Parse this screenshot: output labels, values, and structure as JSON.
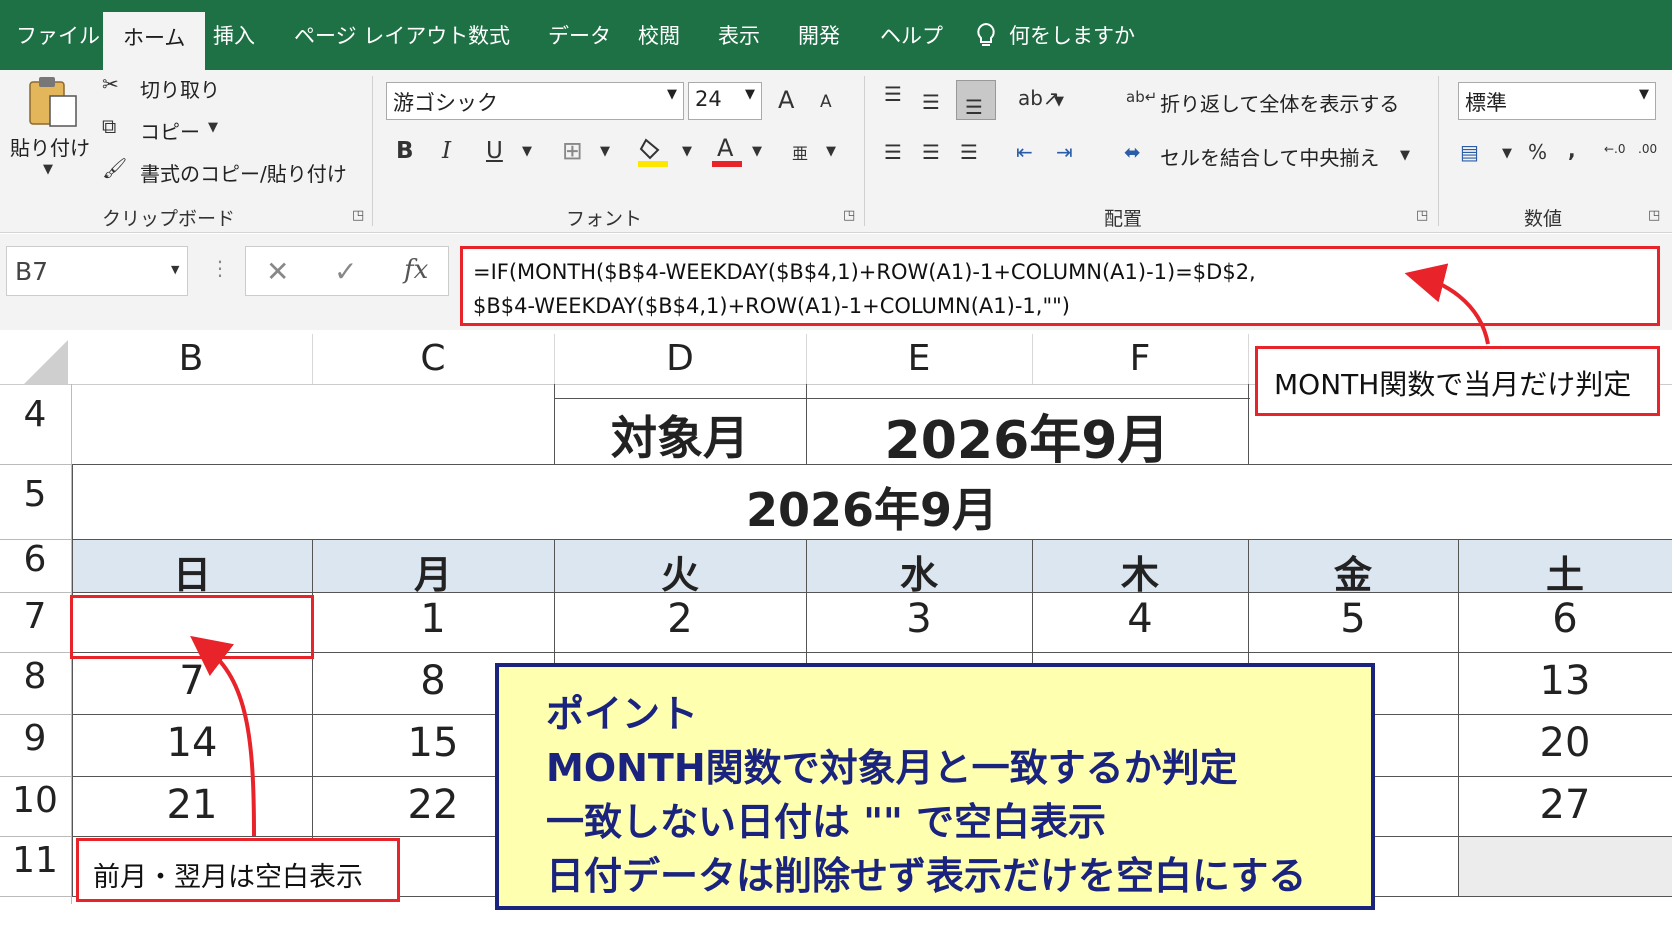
{
  "tabs": [
    "ファイル",
    "ホーム",
    "挿入",
    "ページ レイアウト",
    "数式",
    "データ",
    "校閲",
    "表示",
    "開発",
    "ヘルプ",
    "何をしますか"
  ],
  "ribbon": {
    "clipboard": {
      "paste": "貼り付け",
      "cut": "切り取り",
      "copy": "コピー",
      "format_painter": "書式のコピー/貼り付け",
      "group": "クリップボード"
    },
    "font": {
      "name": "游ゴシック",
      "size": "24",
      "group": "フォント",
      "bold": "B",
      "italic": "I",
      "underline": "U",
      "grow": "A",
      "shrink": "A"
    },
    "alignment": {
      "wrap": "折り返して全体を表示する",
      "merge": "セルを結合して中央揃え",
      "group": "配置"
    },
    "number": {
      "format": "標準",
      "group": "数値",
      "percent": "%",
      "comma": ","
    }
  },
  "formula_bar": {
    "name_box": "B7",
    "fx": "fx",
    "line1": "=IF(MONTH($B$4-WEEKDAY($B$4,1)+ROW(A1)-1+COLUMN(A1)-1)=$D$2,",
    "line2": "$B$4-WEEKDAY($B$4,1)+ROW(A1)-1+COLUMN(A1)-1,\"\")"
  },
  "columns": [
    "B",
    "C",
    "D",
    "E",
    "F"
  ],
  "rows": [
    "4",
    "5",
    "6",
    "7",
    "8",
    "9",
    "10",
    "11"
  ],
  "sheet": {
    "label_target": "対象月",
    "target_value": "2026年9月",
    "calendar_title": "2026年9月",
    "weekdays": [
      "日",
      "月",
      "火",
      "水",
      "木",
      "金",
      "土"
    ],
    "row7": [
      "",
      "1",
      "2",
      "3",
      "4",
      "5",
      "6"
    ],
    "row8_b": "7",
    "row8_c": "8",
    "row8_h": "13",
    "row9_b": "14",
    "row9_c": "15",
    "row9_h": "20",
    "row10_b": "21",
    "row10_c": "22",
    "row10_h": "27"
  },
  "callouts": {
    "month": "MONTH関数で当月だけ判定",
    "blank": "前月・翌月は空白表示"
  },
  "point": {
    "title": "ポイント",
    "line1": "MONTH関数で対象月と一致するか判定",
    "line2": "一致しない日付は \"\" で空白表示",
    "line3": "日付データは削除せず表示だけを空白にする"
  },
  "colors": {
    "excel_green": "#1e7145",
    "callout_red": "#e8232a",
    "weekday_fill": "#dce6f1",
    "point_fill": "#ffffb0",
    "point_text": "#1a237e"
  }
}
